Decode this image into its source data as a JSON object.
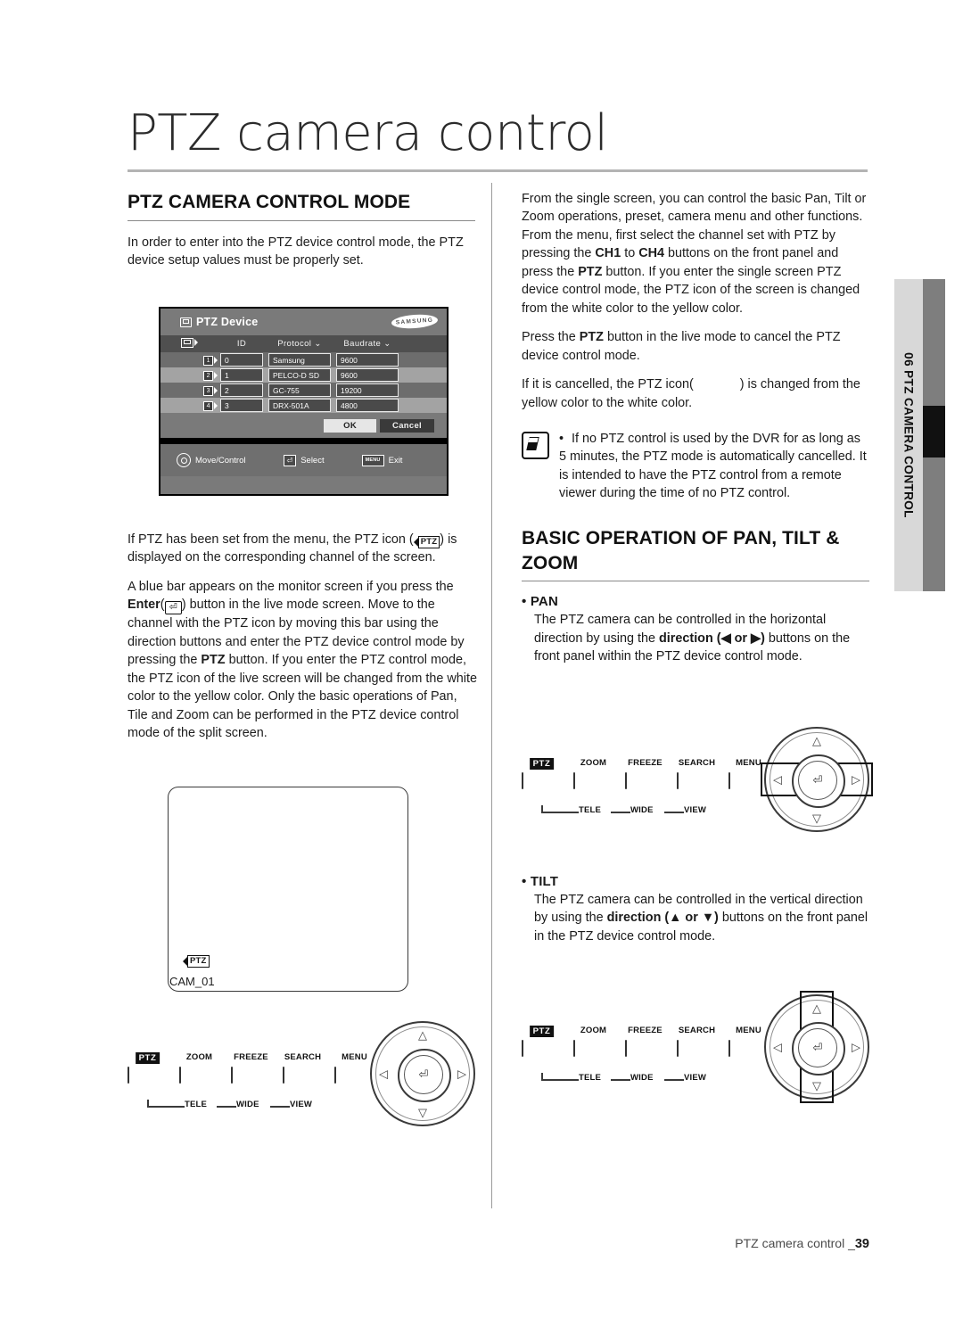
{
  "page": {
    "title": "PTZ camera control",
    "footer_text": "PTZ camera control _",
    "footer_page": "39",
    "side_tab": "06 PTZ CAMERA CONTROL"
  },
  "left": {
    "heading": "PTZ CAMERA CONTROL MODE",
    "intro": "In order to enter into the PTZ device control mode, the PTZ device setup values must be properly set.",
    "para_icon_pre": "If PTZ has been set from the menu, the PTZ icon (",
    "para_icon_post": ") is displayed on the corresponding channel of the screen.",
    "para_blue_a": "A blue bar appears on the monitor screen if you press the ",
    "para_blue_enter": "Enter",
    "para_blue_b": ") button in the live mode screen. Move to the channel with the PTZ icon by moving this bar using the direction buttons and enter the PTZ device control mode by pressing the ",
    "para_blue_ptz": "PTZ",
    "para_blue_c": " button. If you enter the PTZ control mode, the PTZ icon of the live screen will be changed from the white color to the yellow color. Only the basic operations of Pan, Tile and Zoom can be performed in the PTZ device control mode of the split screen.",
    "monitor": {
      "ptz_badge": "PTZ",
      "camera_label": "CAM_01"
    }
  },
  "osd": {
    "title": "PTZ Device",
    "brand": "SAMSUNG",
    "columns": [
      "",
      "ID",
      "Protocol",
      "Baudrate"
    ],
    "rows": [
      {
        "ch": "1",
        "id": "0",
        "protocol": "Samsung",
        "baudrate": "9600"
      },
      {
        "ch": "2",
        "id": "1",
        "protocol": "PELCO-D SD",
        "baudrate": "9600"
      },
      {
        "ch": "3",
        "id": "2",
        "protocol": "GC-755",
        "baudrate": "19200"
      },
      {
        "ch": "4",
        "id": "3",
        "protocol": "DRX-501A",
        "baudrate": "4800"
      }
    ],
    "ok": "OK",
    "cancel": "Cancel",
    "status": [
      {
        "icon": "dpad-icon",
        "label": "Move/Control"
      },
      {
        "icon": "enter-key-icon",
        "label": "Select"
      },
      {
        "icon": "menu-key-icon",
        "label": "Exit"
      }
    ]
  },
  "right": {
    "para1_a": "From the single screen, you can control the basic Pan, Tilt or Zoom operations, preset, camera menu and other functions. From the menu, first select the channel set with PTZ by pressing the ",
    "para1_ch1": "CH1",
    "para1_to": " to ",
    "para1_ch4": "CH4",
    "para1_b": " buttons on the front panel and press the ",
    "para1_ptz": "PTZ",
    "para1_c": " button. If you enter the single screen PTZ device control mode, the PTZ icon of the screen is changed from the white color to the yellow color.",
    "para2_a": "Press the ",
    "para2_ptz": "PTZ",
    "para2_b": " button in the live mode to cancel the PTZ device control mode.",
    "para3_a": "If it is cancelled, the PTZ icon(",
    "para3_b": ") is changed from the yellow color to the white color.",
    "note": "If no PTZ control is used by the DVR for as long as 5 minutes, the PTZ mode is automatically cancelled. It is intended to have the PTZ control from a remote viewer during the time of no PTZ control.",
    "heading2": "BASIC OPERATION OF PAN, TILT & ZOOM",
    "pan": {
      "title": "PAN",
      "text_a": "The PTZ camera can be controlled in the horizontal direction by using the ",
      "bold": "direction",
      "arrows": "(◀ or ▶)",
      "text_b": " buttons on the front panel within the PTZ device control mode."
    },
    "tilt": {
      "title": "TILT",
      "text_a": "The PTZ camera can be controlled in the vertical direction by using the ",
      "bold": "direction",
      "arrows": "(▲ or ▼)",
      "text_b": " buttons on the front panel in the PTZ device control mode."
    }
  },
  "panel": {
    "buttons": [
      "PTZ",
      "ZOOM",
      "FREEZE",
      "SEARCH",
      "MENU"
    ],
    "brace_labels": [
      "TELE",
      "WIDE",
      "VIEW"
    ],
    "dpad": {
      "up": "△",
      "down": "▽",
      "left": "◁",
      "right": "▷",
      "enter": "⏎"
    }
  }
}
